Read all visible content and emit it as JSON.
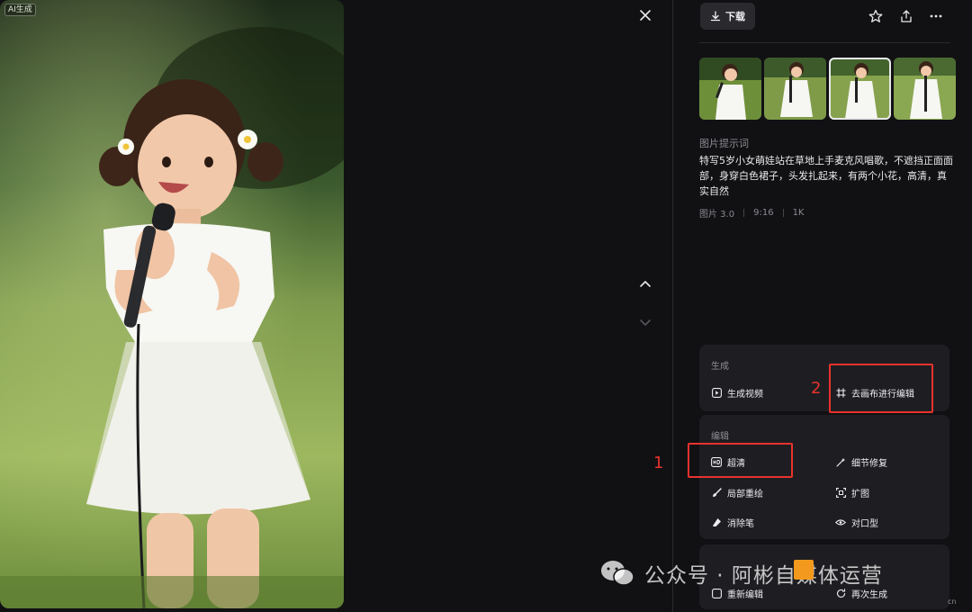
{
  "image": {
    "badge": "AI生成"
  },
  "toolbar": {
    "download_label": "下载"
  },
  "prompt": {
    "label": "图片提示词",
    "text": "特写5岁小女萌娃站在草地上手麦克风唱歌，不遮挡正面面部，身穿白色裙子，头发扎起来，有两个小花，高清，真实自然",
    "meta": [
      "图片 3.0",
      "9:16",
      "1K"
    ]
  },
  "generate": {
    "title": "生成",
    "items": [
      {
        "label": "生成视频",
        "icon": "play-icon"
      },
      {
        "label": "去画布进行编辑",
        "icon": "canvas-icon"
      }
    ]
  },
  "edit": {
    "title": "编辑",
    "items": [
      {
        "label": "超清",
        "icon": "hd-icon"
      },
      {
        "label": "细节修复",
        "icon": "magic-wand-icon"
      },
      {
        "label": "局部重绘",
        "icon": "brush-icon"
      },
      {
        "label": "扩图",
        "icon": "expand-icon"
      },
      {
        "label": "消除笔",
        "icon": "eraser-icon"
      },
      {
        "label": "对口型",
        "icon": "lips-icon"
      }
    ]
  },
  "more": {
    "items": [
      {
        "label": "重新编辑",
        "icon": "edit-icon"
      },
      {
        "label": "再次生成",
        "icon": "refresh-icon"
      }
    ]
  },
  "annotations": [
    "1",
    "2"
  ],
  "watermark": {
    "text": "公众号 · 阿彬自媒体运营",
    "suffix": "cn"
  },
  "colors": {
    "background": "#111114",
    "card": "#1e1e22",
    "annotation": "#e8322c"
  }
}
